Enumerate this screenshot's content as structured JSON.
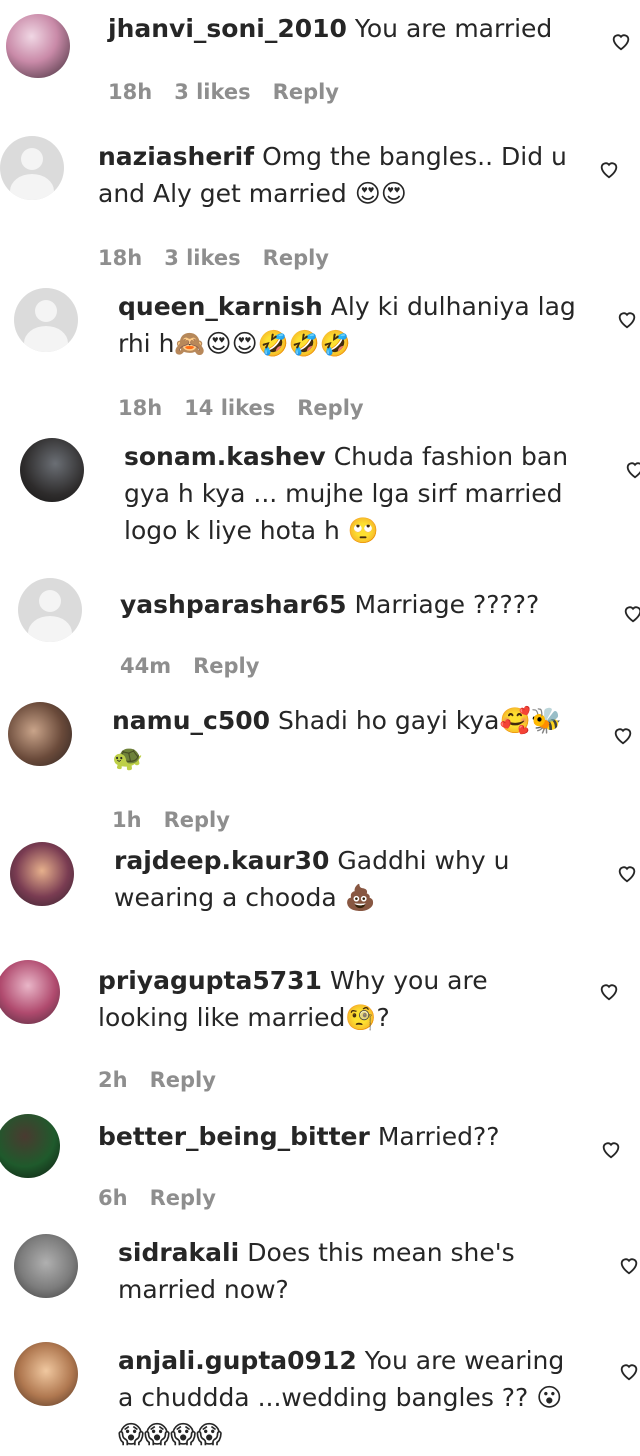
{
  "comments": [
    {
      "username": "jhanvi_soni_2010",
      "text": "You are married",
      "time": "18h",
      "likes": "3 likes",
      "reply": "Reply"
    },
    {
      "username": "naziasherif",
      "text": "Omg the bangles.. Did u and Aly get married 😍😍",
      "time": "18h",
      "likes": "3 likes",
      "reply": "Reply"
    },
    {
      "username": "queen_karnish",
      "text": "Aly ki dulhaniya lag rhi h🙈😍😍🤣🤣🤣",
      "time": "18h",
      "likes": "14 likes",
      "reply": "Reply"
    },
    {
      "username": "sonam.kashev",
      "text": "Chuda fashion ban gya h kya ... mujhe lga sirf married logo k liye hota h 🙄",
      "time": "",
      "likes": "",
      "reply": ""
    },
    {
      "username": "yashparashar65",
      "text": "Marriage ?????",
      "time": "44m",
      "likes": "",
      "reply": "Reply"
    },
    {
      "username": "namu_c500",
      "text": "Shadi ho gayi kya🥰🐝 🐢",
      "time": "1h",
      "likes": "",
      "reply": "Reply"
    },
    {
      "username": "rajdeep.kaur30",
      "text": "Gaddhi why u wearing a chooda 💩",
      "time": "",
      "likes": "",
      "reply": ""
    },
    {
      "username": "priyagupta5731",
      "text": "Why you are looking like married🧐?",
      "time": "2h",
      "likes": "",
      "reply": "Reply"
    },
    {
      "username": "better_being_bitter",
      "text": "Married??",
      "time": "6h",
      "likes": "",
      "reply": "Reply"
    },
    {
      "username": "sidrakali",
      "text": "Does this mean she's married now?",
      "time": "",
      "likes": "",
      "reply": ""
    },
    {
      "username": "anjali.gupta0912",
      "text": "You are wearing a chuddda ...wedding bangles ?? 😮 😱😱😱😱",
      "time": "",
      "likes": "",
      "reply": ""
    }
  ],
  "icons": {
    "avatar_placeholder": "default-avatar-icon",
    "like": "heart-icon"
  }
}
